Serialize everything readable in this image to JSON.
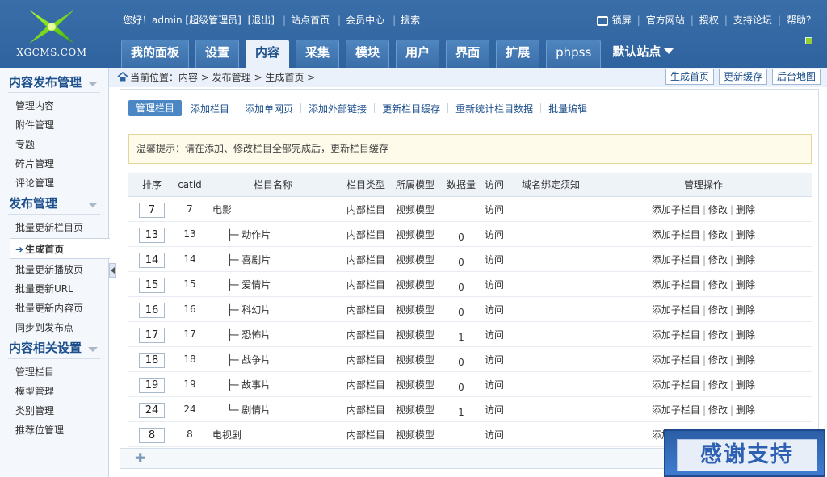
{
  "logo": {
    "text": "XGCMS.COM"
  },
  "user": {
    "greeting": "您好！admin [超级管理员]",
    "logout": "[退出]",
    "site_home": "站点首页",
    "member_center": "会员中心",
    "search": "搜索"
  },
  "toplinks": {
    "lock": "锁屏",
    "official": "官方网站",
    "auth": "授权",
    "forum": "支持论坛",
    "help": "帮助？"
  },
  "tabs": [
    "我的面板",
    "设置",
    "内容",
    "采集",
    "模块",
    "用户",
    "界面",
    "扩展",
    "phpss"
  ],
  "active_tab": "内容",
  "site_select": "默认站点",
  "sidebar": {
    "sections": [
      {
        "title": "内容发布管理",
        "items": [
          "管理内容",
          "附件管理",
          "专题",
          "碎片管理",
          "评论管理"
        ]
      },
      {
        "title": "发布管理",
        "items": [
          "批量更新栏目页",
          "生成首页",
          "批量更新播放页",
          "批量更新URL",
          "批量更新内容页",
          "同步到发布点"
        ]
      },
      {
        "title": "内容相关设置",
        "items": [
          "管理栏目",
          "模型管理",
          "类别管理",
          "推荐位管理"
        ]
      }
    ],
    "active_item": "生成首页"
  },
  "breadcrumb": "当前位置：内容 > 发布管理 > 生成首页 >",
  "right_buttons": [
    "生成首页",
    "更新缓存",
    "后台地图"
  ],
  "actions": [
    "管理栏目",
    "添加栏目",
    "添加单网页",
    "添加外部链接",
    "更新栏目缓存",
    "重新统计栏目数据",
    "批量编辑"
  ],
  "tip": "温馨提示：请在添加、修改栏目全部完成后，更新栏目缓存",
  "table": {
    "headers": [
      "排序",
      "catid",
      "栏目名称",
      "栏目类型",
      "所属模型",
      "数据量",
      "访问",
      "域名绑定须知",
      "管理操作"
    ],
    "rows": [
      {
        "order": "7",
        "catid": "7",
        "name": "电影",
        "child": false,
        "type": "内部栏目",
        "model": "视频模型",
        "count": "",
        "visit": "访问"
      },
      {
        "order": "13",
        "catid": "13",
        "name": "├─ 动作片",
        "child": true,
        "type": "内部栏目",
        "model": "视频模型",
        "count": "0",
        "visit": "访问"
      },
      {
        "order": "14",
        "catid": "14",
        "name": "├─ 喜剧片",
        "child": true,
        "type": "内部栏目",
        "model": "视频模型",
        "count": "0",
        "visit": "访问"
      },
      {
        "order": "15",
        "catid": "15",
        "name": "├─ 爱情片",
        "child": true,
        "type": "内部栏目",
        "model": "视频模型",
        "count": "0",
        "visit": "访问"
      },
      {
        "order": "16",
        "catid": "16",
        "name": "├─ 科幻片",
        "child": true,
        "type": "内部栏目",
        "model": "视频模型",
        "count": "0",
        "visit": "访问"
      },
      {
        "order": "17",
        "catid": "17",
        "name": "├─ 恐怖片",
        "child": true,
        "type": "内部栏目",
        "model": "视频模型",
        "count": "1",
        "visit": "访问"
      },
      {
        "order": "18",
        "catid": "18",
        "name": "├─ 战争片",
        "child": true,
        "type": "内部栏目",
        "model": "视频模型",
        "count": "0",
        "visit": "访问"
      },
      {
        "order": "19",
        "catid": "19",
        "name": "├─ 故事片",
        "child": true,
        "type": "内部栏目",
        "model": "视频模型",
        "count": "0",
        "visit": "访问"
      },
      {
        "order": "24",
        "catid": "24",
        "name": "└─ 剧情片",
        "child": true,
        "type": "内部栏目",
        "model": "视频模型",
        "count": "1",
        "visit": "访问"
      },
      {
        "order": "8",
        "catid": "8",
        "name": "电视剧",
        "child": false,
        "type": "内部栏目",
        "model": "视频模型",
        "count": "",
        "visit": "访问"
      }
    ],
    "ops": [
      "添加子栏目",
      "修改",
      "删除"
    ]
  },
  "thanks": "感谢支持",
  "colors": {
    "header": "#3a6ea8",
    "accent": "#4b86c5",
    "link": "#1c4f8c",
    "tip_bg": "#fffbea"
  }
}
